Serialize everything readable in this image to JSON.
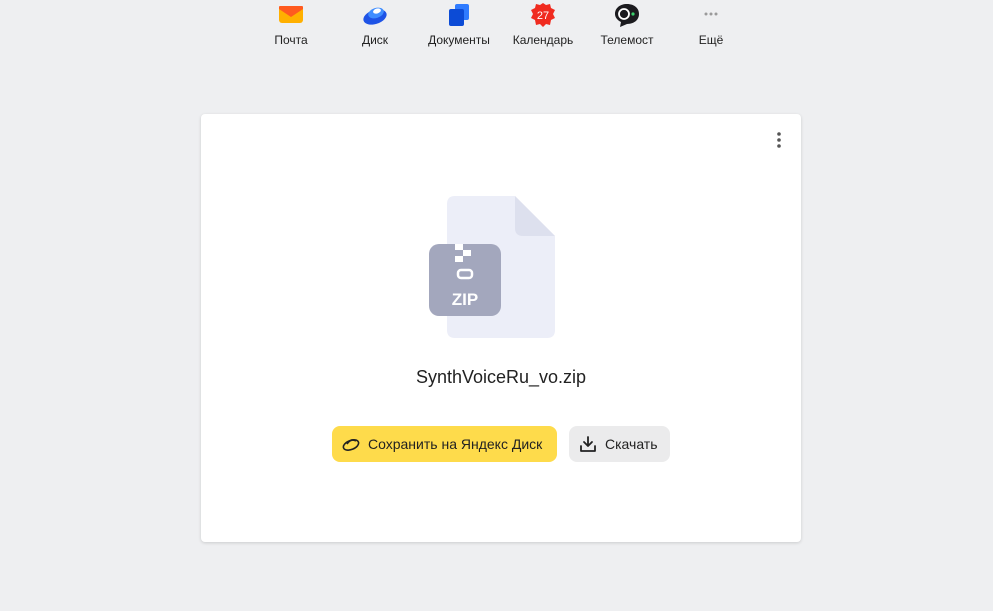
{
  "nav": {
    "items": [
      {
        "label": "Почта",
        "icon": "mail-icon"
      },
      {
        "label": "Диск",
        "icon": "disk-icon"
      },
      {
        "label": "Документы",
        "icon": "documents-icon"
      },
      {
        "label": "Календарь",
        "icon": "calendar-icon",
        "badge": "27"
      },
      {
        "label": "Телемост",
        "icon": "telemost-icon"
      },
      {
        "label": "Ещё",
        "icon": "more-icon"
      }
    ]
  },
  "file": {
    "name": "SynthVoiceRu_vo.zip",
    "type_label": "ZIP"
  },
  "actions": {
    "save_label": "Сохранить на Яндекс Диск",
    "download_label": "Скачать"
  },
  "colors": {
    "background": "#eeeff1",
    "save_button": "#fedb4b",
    "download_button": "#ebebec",
    "zip_badge": "#a3a7bd"
  }
}
